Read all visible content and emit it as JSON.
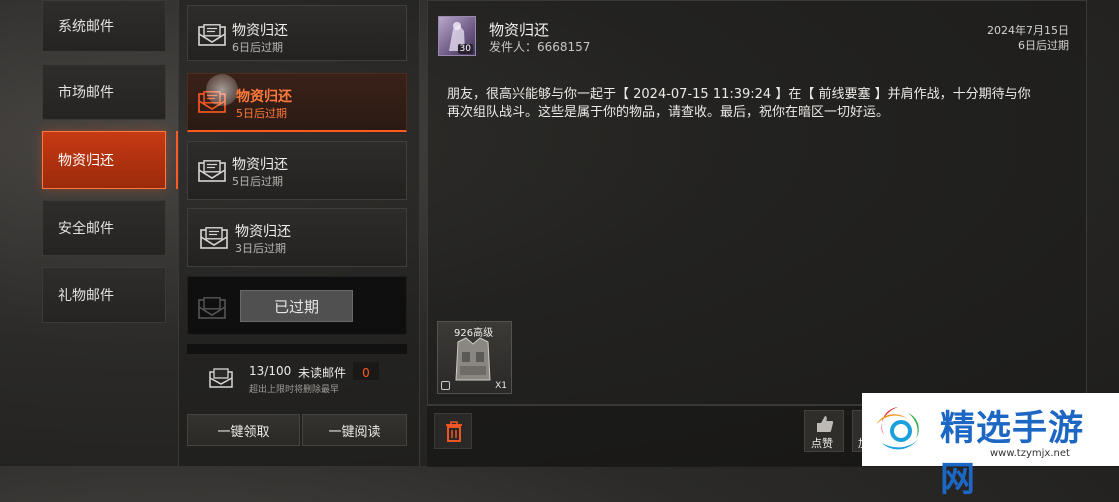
{
  "categories": [
    {
      "label": "系统邮件",
      "active": false
    },
    {
      "label": "市场邮件",
      "active": false
    },
    {
      "label": "物资归还",
      "active": true
    },
    {
      "label": "安全邮件",
      "active": false
    },
    {
      "label": "礼物邮件",
      "active": false
    }
  ],
  "mails": [
    {
      "title": "物资归还",
      "expiry": "6日后过期"
    },
    {
      "title": "物资归还",
      "expiry": "5日后过期"
    },
    {
      "title": "物资归还",
      "expiry": "5日后过期"
    },
    {
      "title": "物资归还",
      "expiry": "3日后过期"
    }
  ],
  "expired_label": "已过期",
  "mail_count": {
    "current": "13/100",
    "unread_label": "未读邮件",
    "unread_count": "0",
    "note": "超出上限时将删除最早"
  },
  "actions": {
    "claim_all": "一键领取",
    "read_all": "一键阅读"
  },
  "detail": {
    "title": "物资归还",
    "sender": "发件人：6668157",
    "date": "2024年7月15日",
    "expiry": "6日后过期",
    "avatar_level": "30",
    "body_line1": "朋友，很高兴能够与你一起于【 2024-07-15 11:39:24 】在【 前线要塞 】并肩作战，十分期待与你",
    "body_line2": "再次组队战斗。这些是属于你的物品，请查收。最后，祝你在暗区一切好运。"
  },
  "attachment": {
    "name": "926高级",
    "count": "X1"
  },
  "footer": {
    "like_label": "点赞",
    "partial_label": "加"
  },
  "watermark": {
    "title": "精选手游网",
    "url": "www.tzymjx.net"
  },
  "colors": {
    "accent": "#ff5a22",
    "unread": "#ff5a22"
  }
}
